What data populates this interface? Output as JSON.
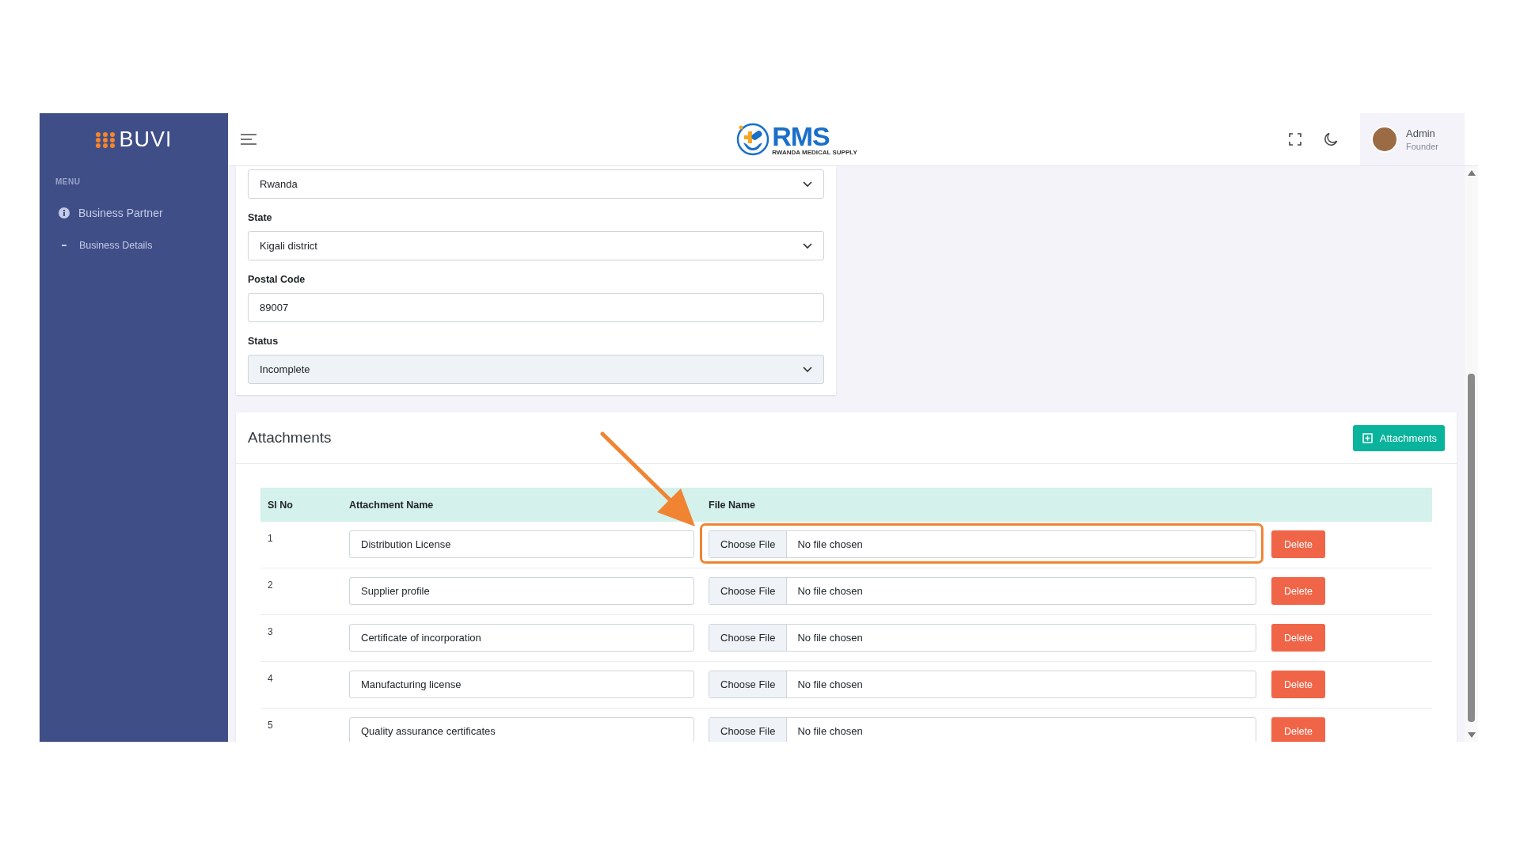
{
  "sidebar": {
    "logo": "BUVI",
    "menu_label": "MENU",
    "items": [
      {
        "label": "Business Partner",
        "children": [
          {
            "label": "Business Details"
          }
        ]
      }
    ]
  },
  "header": {
    "logo": {
      "name": "RMS",
      "tagline": "RWANDA MEDICAL SUPPLY"
    },
    "user": {
      "name": "Admin",
      "role": "Founder"
    }
  },
  "form": {
    "fields": [
      {
        "kind": "select",
        "value": "Rwanda",
        "disabled": false
      },
      {
        "label": "State",
        "kind": "select",
        "value": "Kigali district",
        "disabled": false
      },
      {
        "label": "Postal Code",
        "kind": "text",
        "value": "89007",
        "disabled": false
      },
      {
        "label": "Status",
        "kind": "select",
        "value": "Incomplete",
        "disabled": true
      }
    ]
  },
  "attachments": {
    "title": "Attachments",
    "add_button": "Attachments",
    "columns": [
      "Sl No",
      "Attachment Name",
      "File Name"
    ],
    "rows": [
      {
        "sl": "1",
        "name": "Distribution License",
        "file_button": "Choose File",
        "file_status": "No file chosen",
        "delete": "Delete",
        "highlighted": true
      },
      {
        "sl": "2",
        "name": "Supplier profile",
        "file_button": "Choose File",
        "file_status": "No file chosen",
        "delete": "Delete",
        "highlighted": false
      },
      {
        "sl": "3",
        "name": "Certificate of incorporation",
        "file_button": "Choose File",
        "file_status": "No file chosen",
        "delete": "Delete",
        "highlighted": false
      },
      {
        "sl": "4",
        "name": "Manufacturing license",
        "file_button": "Choose File",
        "file_status": "No file chosen",
        "delete": "Delete",
        "highlighted": false
      },
      {
        "sl": "5",
        "name": "Quality assurance certificates",
        "file_button": "Choose File",
        "file_status": "No file chosen",
        "delete": "Delete",
        "highlighted": false
      }
    ]
  }
}
